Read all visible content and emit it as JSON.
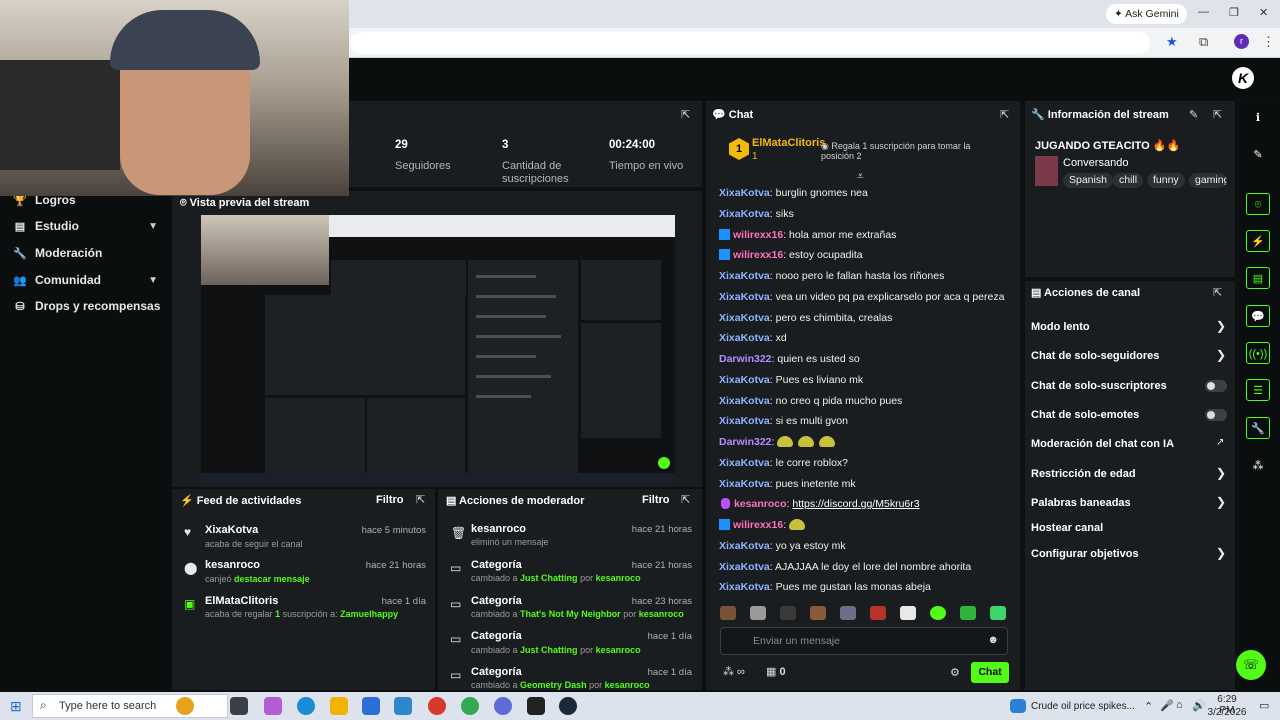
{
  "browser": {
    "ask_gemini": "Ask Gemini",
    "profile_initial": "r"
  },
  "sidebar": {
    "items": [
      {
        "label": "Logros",
        "icon": "trophy-icon"
      },
      {
        "label": "Estudio",
        "icon": "studio-icon"
      },
      {
        "label": "Moderación",
        "icon": "wrench-icon"
      },
      {
        "label": "Comunidad",
        "icon": "community-icon"
      },
      {
        "label": "Drops y recompensas",
        "icon": "drops-icon"
      }
    ]
  },
  "stats": [
    {
      "value": "29",
      "label": "Seguidores"
    },
    {
      "value": "3",
      "label": "Cantidad de suscripciones"
    },
    {
      "value": "00:24:00",
      "label": "Tiempo en vivo"
    }
  ],
  "preview": {
    "title": "Vista previa del stream"
  },
  "activity_feed": {
    "title": "Feed de actividades",
    "filter": "Filtro",
    "items": [
      {
        "user": "XixaKotva",
        "time": "hace 5 minutos",
        "text": "acaba de seguir el canal"
      },
      {
        "user": "kesanroco",
        "time": "hace 21 horas",
        "text": "canjeó",
        "highlight": "destacar mensaje"
      },
      {
        "user": "ElMataClitoris",
        "time": "hace 1 día",
        "text": "acaba de regalar",
        "count": "1",
        "text2": "suscripción a:",
        "target": "Zamuelhappy"
      }
    ]
  },
  "mod_actions": {
    "title": "Acciones de moderador",
    "filter": "Filtro",
    "items": [
      {
        "title": "kesanroco",
        "time": "hace 21 horas",
        "line": "eliminó un mensaje"
      },
      {
        "title": "Categoría",
        "time": "hace 21 horas",
        "prefix": "cambiado a",
        "category": "Just Chatting",
        "by": "por",
        "mod": "kesanroco"
      },
      {
        "title": "Categoría",
        "time": "hace 23 horas",
        "prefix": "cambiado a",
        "category": "That's Not My Neighbor",
        "by": "por",
        "mod": "kesanroco"
      },
      {
        "title": "Categoría",
        "time": "hace 1 día",
        "prefix": "cambiado a",
        "category": "Just Chatting",
        "by": "por",
        "mod": "kesanroco"
      },
      {
        "title": "Categoría",
        "time": "hace 1 día",
        "prefix": "cambiado a",
        "category": "Geometry Dash",
        "by": "por",
        "mod": "kesanroco"
      }
    ]
  },
  "chat": {
    "title": "Chat",
    "pinned": {
      "user": "ElMataClitoris",
      "rank": "1",
      "message": "Regala 1 suscripción para tomar la posición 2"
    },
    "messages": [
      {
        "user": "XixaKotva",
        "color": "blue",
        "text": "burglin gnomes nea"
      },
      {
        "user": "XixaKotva",
        "color": "blue",
        "text": "siks"
      },
      {
        "user": "wilirexx16",
        "color": "pink",
        "badge": "sub",
        "text": "hola amor me extrañas"
      },
      {
        "user": "wilirexx16",
        "color": "pink",
        "badge": "sub",
        "text": "estoy ocupadita"
      },
      {
        "user": "XixaKotva",
        "color": "blue",
        "text": "nooo pero le fallan hasta los riñones"
      },
      {
        "user": "XixaKotva",
        "color": "blue",
        "text": "vea un video pq pa explicarselo por aca q pereza"
      },
      {
        "user": "XixaKotva",
        "color": "blue",
        "text": "pero es chimbita, crealas"
      },
      {
        "user": "XixaKotva",
        "color": "blue",
        "text": "xd"
      },
      {
        "user": "Darwin322",
        "color": "purple",
        "text": "quien es usted so"
      },
      {
        "user": "XixaKotva",
        "color": "blue",
        "text": "Pues es liviano mk"
      },
      {
        "user": "XixaKotva",
        "color": "blue",
        "text": "no creo q pida mucho pues"
      },
      {
        "user": "XixaKotva",
        "color": "blue",
        "text": "si es multi gvon"
      },
      {
        "user": "Darwin322",
        "color": "purple",
        "text": "",
        "emotes": 3
      },
      {
        "user": "XixaKotva",
        "color": "blue",
        "text": "le corre roblox?"
      },
      {
        "user": "XixaKotva",
        "color": "blue",
        "text": "pues inetente mk"
      },
      {
        "user": "kesanroco",
        "color": "pink",
        "badge": "mic",
        "text": "",
        "link": "https://discord.gg/M5kru6r3"
      },
      {
        "user": "wilirexx16",
        "color": "pink",
        "badge": "sub",
        "text": "",
        "emotes": 1
      },
      {
        "user": "XixaKotva",
        "color": "blue",
        "text": "yo ya estoy mk"
      },
      {
        "user": "XixaKotva",
        "color": "blue",
        "text": "AJAJJAA le doy el lore del nombre ahorita"
      },
      {
        "user": "XixaKotva",
        "color": "blue",
        "text": "Pues me gustan las monas abeja"
      }
    ],
    "input_placeholder": "Enviar un mensaje",
    "points": "0",
    "send_label": "Chat"
  },
  "stream_info": {
    "title": "Información del stream",
    "stream_title": "JUGANDO GTEACITO 🔥🔥",
    "category": "Conversando",
    "tags": [
      "Spanish",
      "chill",
      "funny",
      "gaming"
    ]
  },
  "channel_actions": {
    "title": "Acciones de canal",
    "items": [
      {
        "label": "Modo lento",
        "kind": "chevron"
      },
      {
        "label": "Chat de solo-seguidores",
        "kind": "chevron"
      },
      {
        "label": "Chat de solo-suscriptores",
        "kind": "toggle"
      },
      {
        "label": "Chat de solo-emotes",
        "kind": "toggle"
      },
      {
        "label": "Moderación del chat con IA",
        "kind": "external"
      },
      {
        "label": "Restricción de edad",
        "kind": "chevron"
      },
      {
        "label": "Palabras baneadas",
        "kind": "chevron"
      },
      {
        "label": "Hostear canal",
        "kind": "none"
      },
      {
        "label": "Configurar objetivos",
        "kind": "chevron"
      }
    ]
  },
  "taskbar": {
    "search_placeholder": "Type here to search",
    "news": "Crude oil price spikes...",
    "time": "6:29 PM",
    "date": "3/2/2026"
  },
  "colors": {
    "accent": "#53fc18",
    "panel": "#1a1d1f",
    "background": "#0d0f10"
  }
}
